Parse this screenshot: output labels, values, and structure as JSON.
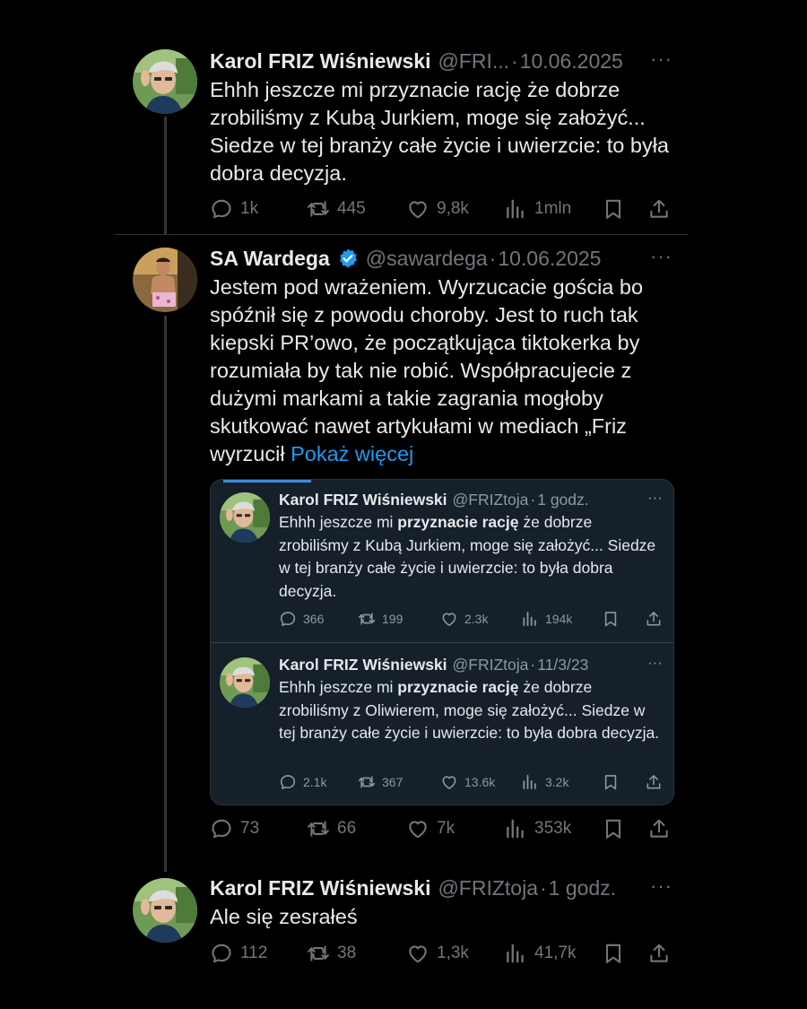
{
  "tweets": [
    {
      "name": "Karol FRIZ Wiśniewski",
      "handle": "@FRI...",
      "dot": "·",
      "date": "10.06.2025",
      "more": "···",
      "text": "Ehhh jeszcze mi przyznacie rację że dobrze zrobiliśmy z Kubą Jurkiem, moge się założyć... Siedze w tej branży całe życie i uwierzcie: to była dobra decyzja.",
      "replies": "1k",
      "retweets": "445",
      "likes": "9,8k",
      "views": "1mln"
    },
    {
      "name": "SA Wardega",
      "handle": "@sawardega",
      "dot": "·",
      "date": "10.06.2025",
      "more": "···",
      "text": "Jestem pod wrażeniem. Wyrzucacie gościa bo spóźnił się z powodu choroby. Jest to ruch tak kiepski PR’owo, że początkująca tiktokerka by rozumiała by tak nie robić. Współpracujecie z dużymi markami a takie zagrania mogłoby skutkować nawet artykułami w mediach „Friz wyrzucił ",
      "show_more": "Pokaż więcej",
      "replies": "73",
      "retweets": "66",
      "likes": "7k",
      "views": "353k"
    },
    {
      "name": "Karol FRIZ Wiśniewski",
      "handle": "@FRIZtoja",
      "dot": "·",
      "date": "1 godz.",
      "more": "···",
      "text": "Ale się zesrałeś",
      "replies": "112",
      "retweets": "38",
      "likes": "1,3k",
      "views": "41,7k"
    }
  ],
  "quote": [
    {
      "name": "Karol FRIZ Wiśniewski",
      "handle": "@FRIZtoja",
      "dot": "·",
      "date": "1 godz.",
      "more": "···",
      "text_a": "Ehhh jeszcze mi ",
      "text_bold": "przyznacie rację",
      "text_b": " że dobrze zrobiliśmy z Kubą Jurkiem, moge się założyć... Siedze w tej branży całe życie i uwierzcie: to była dobra decyzja.",
      "replies": "366",
      "retweets": "199",
      "likes": "2.3k",
      "views": "194k"
    },
    {
      "name": "Karol FRIZ Wiśniewski",
      "handle": "@FRIZtoja",
      "dot": "·",
      "date": "11/3/23",
      "more": "···",
      "text_a": "Ehhh jeszcze mi ",
      "text_bold": "przyznacie rację",
      "text_b": " że dobrze zrobiliśmy z Oliwierem, moge się założyć... Siedze w tej branży całe życie i uwierzcie: to była dobra decyzja.",
      "replies": "2.1k",
      "retweets": "367",
      "likes": "13.6k",
      "views": "3.2k"
    }
  ],
  "colors": {
    "background": "#000000",
    "text": "#e7e9ea",
    "muted": "#71767b",
    "link": "#1d9bf0",
    "verified": "#1d9bf0",
    "quote_bg": "#15202b"
  },
  "icons": [
    "reply-icon",
    "retweet-icon",
    "like-icon",
    "views-icon",
    "bookmark-icon",
    "share-icon",
    "verified-badge-icon",
    "more-icon"
  ]
}
